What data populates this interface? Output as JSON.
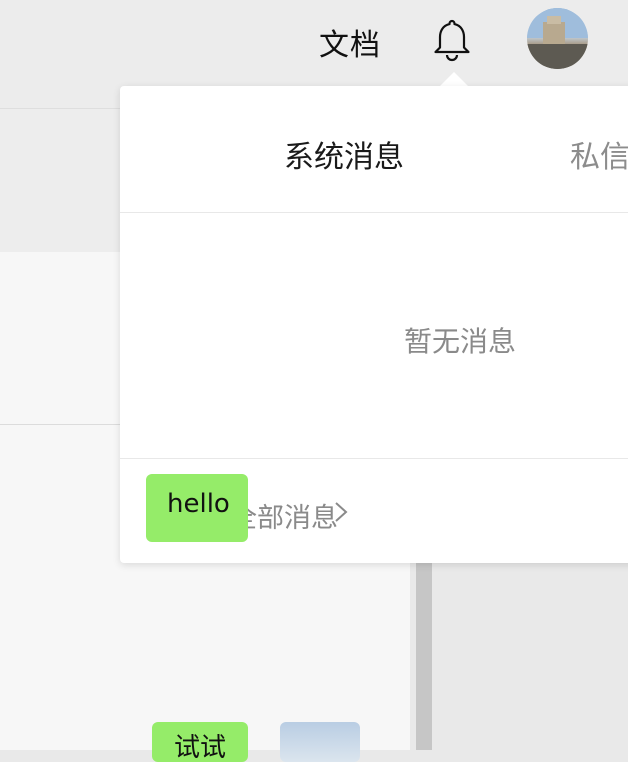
{
  "header": {
    "docs_label": "文档",
    "bell_icon": "bell-icon",
    "avatar_alt": ""
  },
  "notifications": {
    "tabs": [
      {
        "label": "系统消息"
      },
      {
        "label": "私信"
      }
    ],
    "empty_text": "暂无消息",
    "view_all_label": "全部消息"
  },
  "overlay": {
    "bubble_text": "hello"
  },
  "chat_preview": {
    "bubble_text": "试试"
  },
  "colors": {
    "bubble_green": "#95ec69",
    "popover_bg": "#ffffff",
    "muted_text": "#8a8a8a"
  }
}
